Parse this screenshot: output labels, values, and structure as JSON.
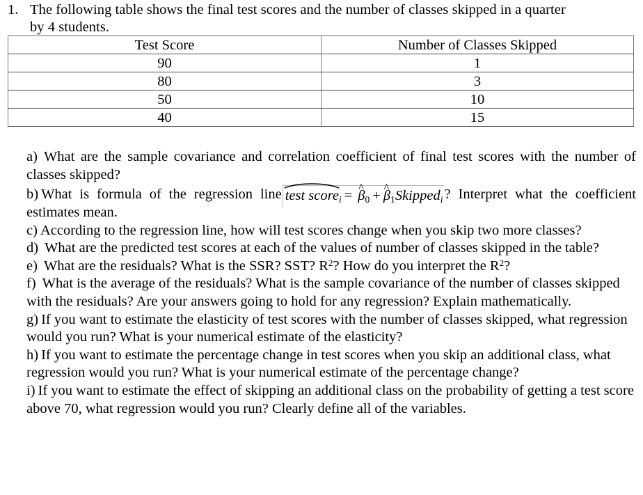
{
  "question": {
    "number": "1.",
    "stem_line1": "The following table shows the final test scores and the number of classes skipped in a quarter",
    "stem_line2": "by 4 students."
  },
  "table": {
    "headers": [
      "Test Score",
      "Number of Classes Skipped"
    ],
    "rows": [
      [
        "90",
        "1"
      ],
      [
        "80",
        "3"
      ],
      [
        "50",
        "10"
      ],
      [
        "40",
        "15"
      ]
    ]
  },
  "parts": {
    "a": {
      "label": "a)",
      "text": "What are the sample covariance and correlation coefficient of final test scores with the number of classes skipped?"
    },
    "b": {
      "label": "b)",
      "text_before": "What is formula of the regression line",
      "equation": {
        "lhs": "test score",
        "lhs_subscript": "i",
        "equals": "=",
        "beta0": "β",
        "beta0_sub": "0",
        "plus": "+",
        "beta1": "β",
        "beta1_sub": "1",
        "regressor": "Skipped",
        "regressor_subscript": "i",
        "hat_symbol": "^"
      },
      "text_after": "? Interpret what the coefficient estimates mean."
    },
    "c": {
      "label": "c)",
      "text": "According to the regression line, how will test scores change when you skip two more classes?"
    },
    "d": {
      "label": "d)",
      "text": "What are the predicted test scores at each of the values of number of classes skipped in the table?"
    },
    "e": {
      "label": "e)",
      "seg1": "What are the residuals? What is the SSR? SST? R",
      "sup1": "2",
      "seg2": "? How do you interpret the R",
      "sup2": "2",
      "seg3": "?"
    },
    "f": {
      "label": "f)",
      "text": "What is the average of the residuals? What is the sample covariance of the number of classes skipped with the residuals? Are your answers going to hold for any regression? Explain mathematically."
    },
    "g": {
      "label": "g)",
      "text": "If you want to estimate the elasticity of test scores with the number of classes skipped, what regression would you run? What is your numerical estimate of the elasticity?"
    },
    "h": {
      "label": "h)",
      "text": "If you want to estimate the percentage change in test scores when you skip an additional class, what regression would you run? What is your numerical estimate of the percentage change?"
    },
    "i": {
      "label": "i)",
      "text": "If you want to estimate the effect of skipping an additional class on the probability of getting a test score above 70, what regression would you run? Clearly define all of the variables."
    }
  }
}
